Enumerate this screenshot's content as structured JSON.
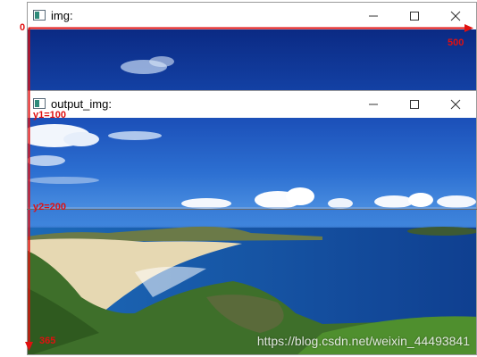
{
  "windows": {
    "img": {
      "title": "img:",
      "icon": "image-app-icon",
      "controls": [
        "minimize-icon",
        "maximize-icon",
        "close-icon"
      ]
    },
    "output_img": {
      "title": "output_img:",
      "icon": "image-app-icon",
      "controls": [
        "minimize-icon",
        "maximize-icon",
        "close-icon"
      ]
    }
  },
  "annotations": {
    "origin": "0",
    "x_max": "500",
    "y1": "y1=100",
    "y2": "y2=200",
    "y_max": "365"
  },
  "watermark": "https://blog.csdn.net/weixin_44493841",
  "colors": {
    "annotation": "#e01010",
    "sky_top": "#0b2e88",
    "sky_mid": "#1f5fc8",
    "sky_low": "#4f8fe0",
    "sea": "#1a55a8",
    "sand": "#e8dcb8",
    "grass": "#3f7a2a"
  }
}
